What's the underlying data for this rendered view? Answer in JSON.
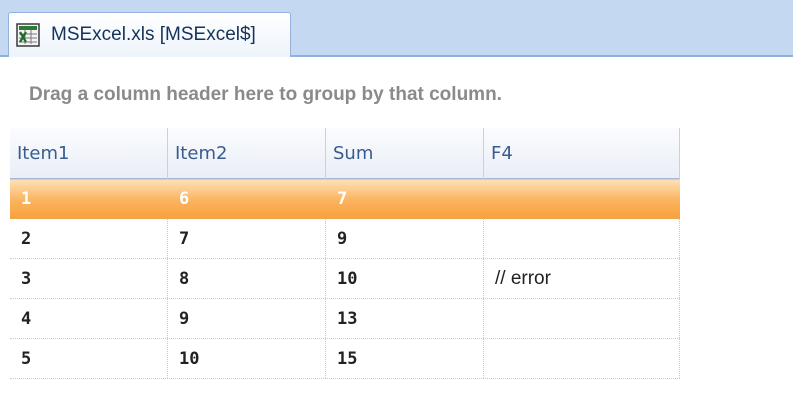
{
  "tab": {
    "label": "MSExcel.xls [MSExcel$]",
    "icon": "excel-file-icon"
  },
  "group_panel": {
    "hint": "Drag a column header here to group by that column."
  },
  "grid": {
    "columns": [
      "Item1",
      "Item2",
      "Sum",
      "F4"
    ],
    "rows": [
      [
        "1",
        "6",
        "7",
        ""
      ],
      [
        "2",
        "7",
        "9",
        ""
      ],
      [
        "3",
        "8",
        "10",
        "// error"
      ],
      [
        "4",
        "9",
        "13",
        ""
      ],
      [
        "5",
        "10",
        "15",
        ""
      ]
    ],
    "selected_row": 0
  },
  "colors": {
    "tabstrip": "#c4d8f2",
    "header_text": "#385c8e",
    "selection": "#fbb35d"
  }
}
